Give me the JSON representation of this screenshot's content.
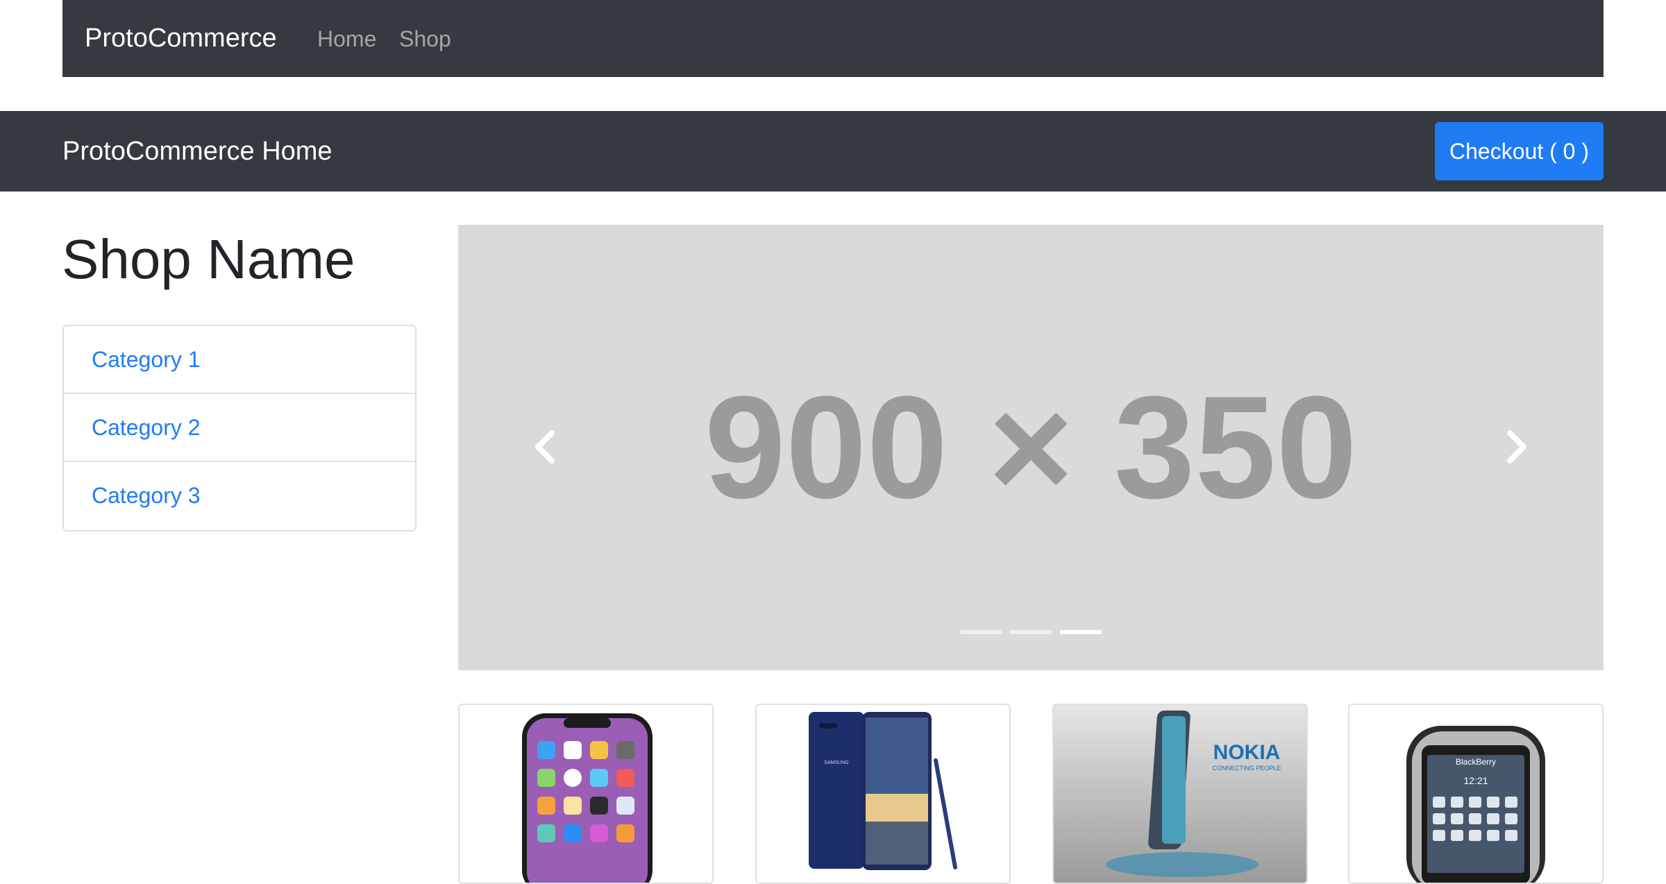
{
  "top_nav": {
    "brand": "ProtoCommerce",
    "links": [
      "Home",
      "Shop"
    ]
  },
  "sub_nav": {
    "title": "ProtoCommerce Home",
    "checkout_label": "Checkout ( 0 )"
  },
  "sidebar": {
    "shop_name": "Shop Name",
    "categories": [
      "Category 1",
      "Category 2",
      "Category 3"
    ]
  },
  "carousel": {
    "placeholder_text": "900 × 350",
    "slide_count": 3,
    "active_slide": 3
  },
  "products": [
    {
      "image": "iphone-x-phone-image"
    },
    {
      "image": "samsung-galaxy-note-8-phone-image",
      "brand_text": "SAMSUNG"
    },
    {
      "image": "nokia-edge-phone-image",
      "brand_text": "NOKIA",
      "tagline": "CONNECTING PEOPLE"
    },
    {
      "image": "blackberry-phone-image",
      "brand_text": "BlackBerry",
      "clock": "12:21"
    }
  ],
  "colors": {
    "navbar_bg": "#343a40",
    "primary": "#1f7cf5",
    "carousel_bg": "#dadada"
  }
}
